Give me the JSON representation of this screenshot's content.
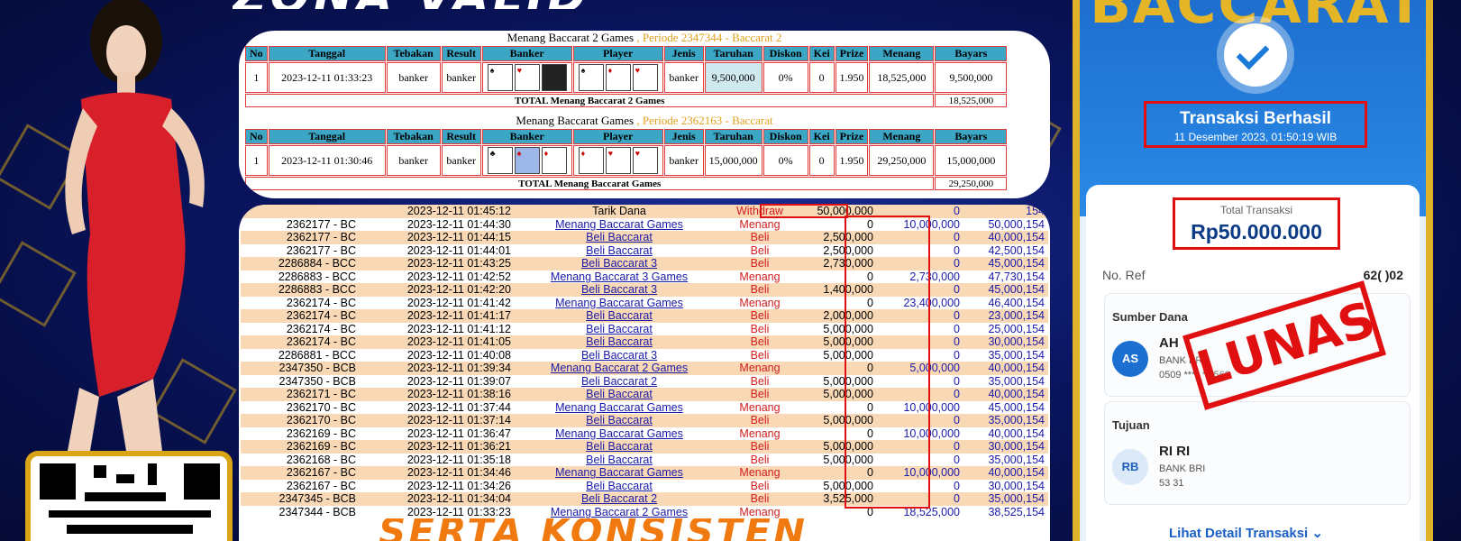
{
  "banner_top": "ZONA VALID",
  "banner_bottom": "SERTA KONSISTEN",
  "game1": {
    "caption": "Menang Baccarat 2 Games",
    "periode": ", Periode 2347344 - Baccarat 2",
    "headers": [
      "No",
      "Tanggal",
      "Tebakan",
      "Result",
      "Banker",
      "Player",
      "Jenis",
      "Taruhan",
      "Diskon",
      "Kei",
      "Prize",
      "Menang",
      "Bayars"
    ],
    "row": {
      "no": "1",
      "tanggal": "2023-12-11 01:33:23",
      "tebakan": "banker",
      "result": "banker",
      "jenis": "banker",
      "taruhan": "9,500,000",
      "diskon": "0%",
      "kei": "0",
      "prize": "1.950",
      "menang": "18,525,000",
      "bayars": "9,500,000"
    },
    "total_label": "TOTAL  Menang Baccarat 2 Games",
    "total_value": "18,525,000"
  },
  "game2": {
    "caption": "Menang Baccarat Games",
    "periode": ", Periode 2362163 - Baccarat",
    "headers": [
      "No",
      "Tanggal",
      "Tebakan",
      "Result",
      "Banker",
      "Player",
      "Jenis",
      "Taruhan",
      "Diskon",
      "Kei",
      "Prize",
      "Menang",
      "Bayars"
    ],
    "row": {
      "no": "1",
      "tanggal": "2023-12-11 01:30:46",
      "tebakan": "banker",
      "result": "banker",
      "jenis": "banker",
      "taruhan": "15,000,000",
      "diskon": "0%",
      "kei": "0",
      "prize": "1.950",
      "menang": "29,250,000",
      "bayars": "15,000,000"
    },
    "total_label": "TOTAL  Menang Baccarat Games",
    "total_value": "29,250,000"
  },
  "log": [
    [
      "",
      "2023-12-11 01:45:12",
      "Tarik Dana",
      "Withdraw",
      "50,000,000",
      "0",
      "154"
    ],
    [
      "2362177 - BC",
      "2023-12-11 01:44:30",
      "Menang Baccarat Games",
      "Menang",
      "0",
      "10,000,000",
      "50,000,154"
    ],
    [
      "2362177 - BC",
      "2023-12-11 01:44:15",
      "Beli Baccarat",
      "Beli",
      "2,500,000",
      "0",
      "40,000,154"
    ],
    [
      "2362177 - BC",
      "2023-12-11 01:44:01",
      "Beli Baccarat",
      "Beli",
      "2,500,000",
      "0",
      "42,500,154"
    ],
    [
      "2286884 - BCC",
      "2023-12-11 01:43:25",
      "Beli Baccarat 3",
      "Beli",
      "2,730,000",
      "0",
      "45,000,154"
    ],
    [
      "2286883 - BCC",
      "2023-12-11 01:42:52",
      "Menang Baccarat 3 Games",
      "Menang",
      "0",
      "2,730,000",
      "47,730,154"
    ],
    [
      "2286883 - BCC",
      "2023-12-11 01:42:20",
      "Beli Baccarat 3",
      "Beli",
      "1,400,000",
      "0",
      "45,000,154"
    ],
    [
      "2362174 - BC",
      "2023-12-11 01:41:42",
      "Menang Baccarat Games",
      "Menang",
      "0",
      "23,400,000",
      "46,400,154"
    ],
    [
      "2362174 - BC",
      "2023-12-11 01:41:17",
      "Beli Baccarat",
      "Beli",
      "2,000,000",
      "0",
      "23,000,154"
    ],
    [
      "2362174 - BC",
      "2023-12-11 01:41:12",
      "Beli Baccarat",
      "Beli",
      "5,000,000",
      "0",
      "25,000,154"
    ],
    [
      "2362174 - BC",
      "2023-12-11 01:41:05",
      "Beli Baccarat",
      "Beli",
      "5,000,000",
      "0",
      "30,000,154"
    ],
    [
      "2286881 - BCC",
      "2023-12-11 01:40:08",
      "Beli Baccarat 3",
      "Beli",
      "5,000,000",
      "0",
      "35,000,154"
    ],
    [
      "2347350 - BCB",
      "2023-12-11 01:39:34",
      "Menang Baccarat 2 Games",
      "Menang",
      "0",
      "5,000,000",
      "40,000,154"
    ],
    [
      "2347350 - BCB",
      "2023-12-11 01:39:07",
      "Beli Baccarat 2",
      "Beli",
      "5,000,000",
      "0",
      "35,000,154"
    ],
    [
      "2362171 - BC",
      "2023-12-11 01:38:16",
      "Beli Baccarat",
      "Beli",
      "5,000,000",
      "0",
      "40,000,154"
    ],
    [
      "2362170 - BC",
      "2023-12-11 01:37:44",
      "Menang Baccarat Games",
      "Menang",
      "0",
      "10,000,000",
      "45,000,154"
    ],
    [
      "2362170 - BC",
      "2023-12-11 01:37:14",
      "Beli Baccarat",
      "Beli",
      "5,000,000",
      "0",
      "35,000,154"
    ],
    [
      "2362169 - BC",
      "2023-12-11 01:36:47",
      "Menang Baccarat Games",
      "Menang",
      "0",
      "10,000,000",
      "40,000,154"
    ],
    [
      "2362169 - BC",
      "2023-12-11 01:36:21",
      "Beli Baccarat",
      "Beli",
      "5,000,000",
      "0",
      "30,000,154"
    ],
    [
      "2362168 - BC",
      "2023-12-11 01:35:18",
      "Beli Baccarat",
      "Beli",
      "5,000,000",
      "0",
      "35,000,154"
    ],
    [
      "2362167 - BC",
      "2023-12-11 01:34:46",
      "Menang Baccarat Games",
      "Menang",
      "0",
      "10,000,000",
      "40,000,154"
    ],
    [
      "2362167 - BC",
      "2023-12-11 01:34:26",
      "Beli Baccarat",
      "Beli",
      "5,000,000",
      "0",
      "30,000,154"
    ],
    [
      "2347345 - BCB",
      "2023-12-11 01:34:04",
      "Beli Baccarat 2",
      "Beli",
      "3,525,000",
      "0",
      "35,000,154"
    ],
    [
      "2347344 - BCB",
      "2023-12-11 01:33:23",
      "Menang Baccarat 2 Games",
      "Menang",
      "0",
      "18,525,000",
      "38,525,154"
    ]
  ],
  "phone": {
    "brand": "BACCARAT",
    "status_title": "Transaksi Berhasil",
    "status_date": "11 Desember 2023, 01:50:19 WIB",
    "total_label": "Total Transaksi",
    "total_amount": "Rp50.000.000",
    "ref_label": "No. Ref",
    "ref_value": "62(    )02",
    "source_title": "Sumber Dana",
    "source_initials": "AS",
    "source_name": "AH",
    "source_bank": "BANK BRI",
    "source_account": "0509 ****  ***568",
    "dest_title": "Tujuan",
    "dest_initials": "RB",
    "dest_name": "RI                RI",
    "dest_bank": "BANK BRI",
    "dest_account": "53                   31",
    "stamp": "LUNAS",
    "detail_link": "Lihat Detail Transaksi ⌄"
  },
  "colors": {
    "accent_blue": "#1b74d6",
    "gold": "#e0b22a",
    "stamp_red": "#e01010"
  }
}
